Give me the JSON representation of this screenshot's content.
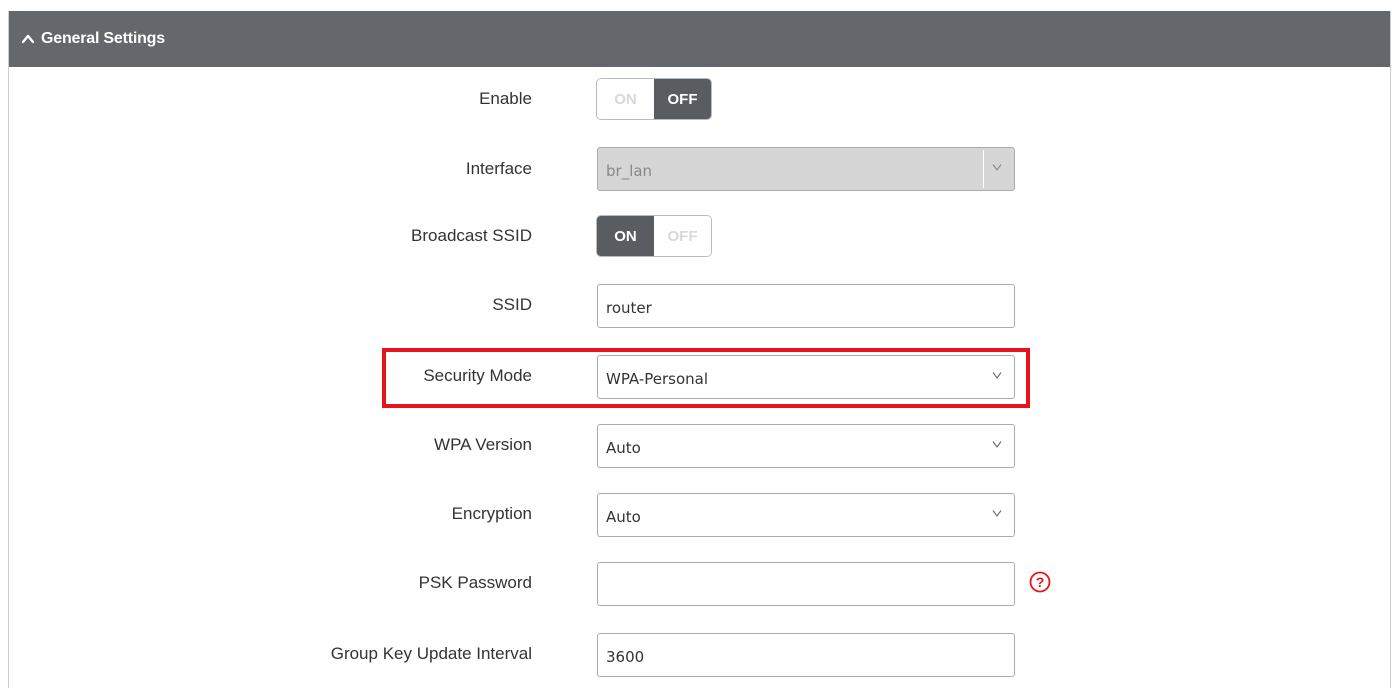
{
  "section": {
    "title": "General Settings",
    "collapse_icon": "chevron-up-icon"
  },
  "toggle_labels": {
    "on": "ON",
    "off": "OFF"
  },
  "fields": {
    "enable": {
      "label": "Enable",
      "state": "OFF"
    },
    "interface": {
      "label": "Interface",
      "value": "br_lan",
      "disabled": true
    },
    "broadcast_ssid": {
      "label": "Broadcast SSID",
      "state": "ON"
    },
    "ssid": {
      "label": "SSID",
      "value": "router"
    },
    "security_mode": {
      "label": "Security Mode",
      "value": "WPA-Personal",
      "highlighted": true
    },
    "wpa_version": {
      "label": "WPA Version",
      "value": "Auto"
    },
    "encryption": {
      "label": "Encryption",
      "value": "Auto"
    },
    "psk_password": {
      "label": "PSK Password",
      "value": "",
      "help_icon": "help-circle-icon"
    },
    "group_key_update_interval": {
      "label": "Group Key Update Interval",
      "value": "3600"
    }
  },
  "colors": {
    "header_bg": "#64676b",
    "toggle_active": "#595c60",
    "highlight": "#e8141b",
    "help_icon": "#e8141b"
  }
}
